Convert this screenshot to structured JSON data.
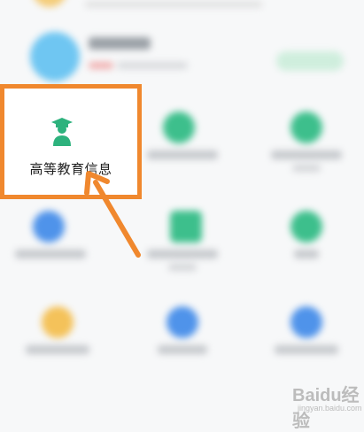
{
  "highlighted_item": {
    "label": "高等教育信息",
    "icon": "graduate-icon",
    "icon_color": "#2db27d"
  },
  "annotation": {
    "color": "#f0882e"
  },
  "watermark": {
    "brand": "Baidu经验",
    "url": "jingyan.baidu.com"
  },
  "colors": {
    "green": "#3dbf8c",
    "blue": "#4f93ea",
    "yellow": "#f4c25a"
  }
}
